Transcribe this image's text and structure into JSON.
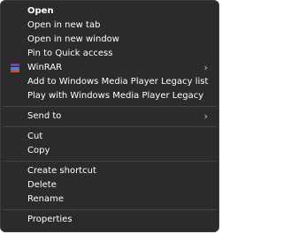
{
  "context_menu": {
    "items": [
      {
        "label": "Open"
      },
      {
        "label": "Open in new tab"
      },
      {
        "label": "Open in new window"
      },
      {
        "label": "Pin to Quick access"
      },
      {
        "label": "WinRAR"
      },
      {
        "label": "Add to Windows Media Player Legacy list"
      },
      {
        "label": "Play with Windows Media Player Legacy"
      },
      {
        "label": "Send to"
      },
      {
        "label": "Cut"
      },
      {
        "label": "Copy"
      },
      {
        "label": "Create shortcut"
      },
      {
        "label": "Delete"
      },
      {
        "label": "Rename"
      },
      {
        "label": "Properties"
      }
    ],
    "icons": {
      "winrar": "winrar-icon",
      "submenu": "chevron-right-icon"
    },
    "colors": {
      "background": "#2b2b2b",
      "text": "#ffffff",
      "separator": "#454545",
      "winrar_stripes": [
        "#7b3fb5",
        "#2f8fdf",
        "#d94a3c"
      ]
    }
  }
}
